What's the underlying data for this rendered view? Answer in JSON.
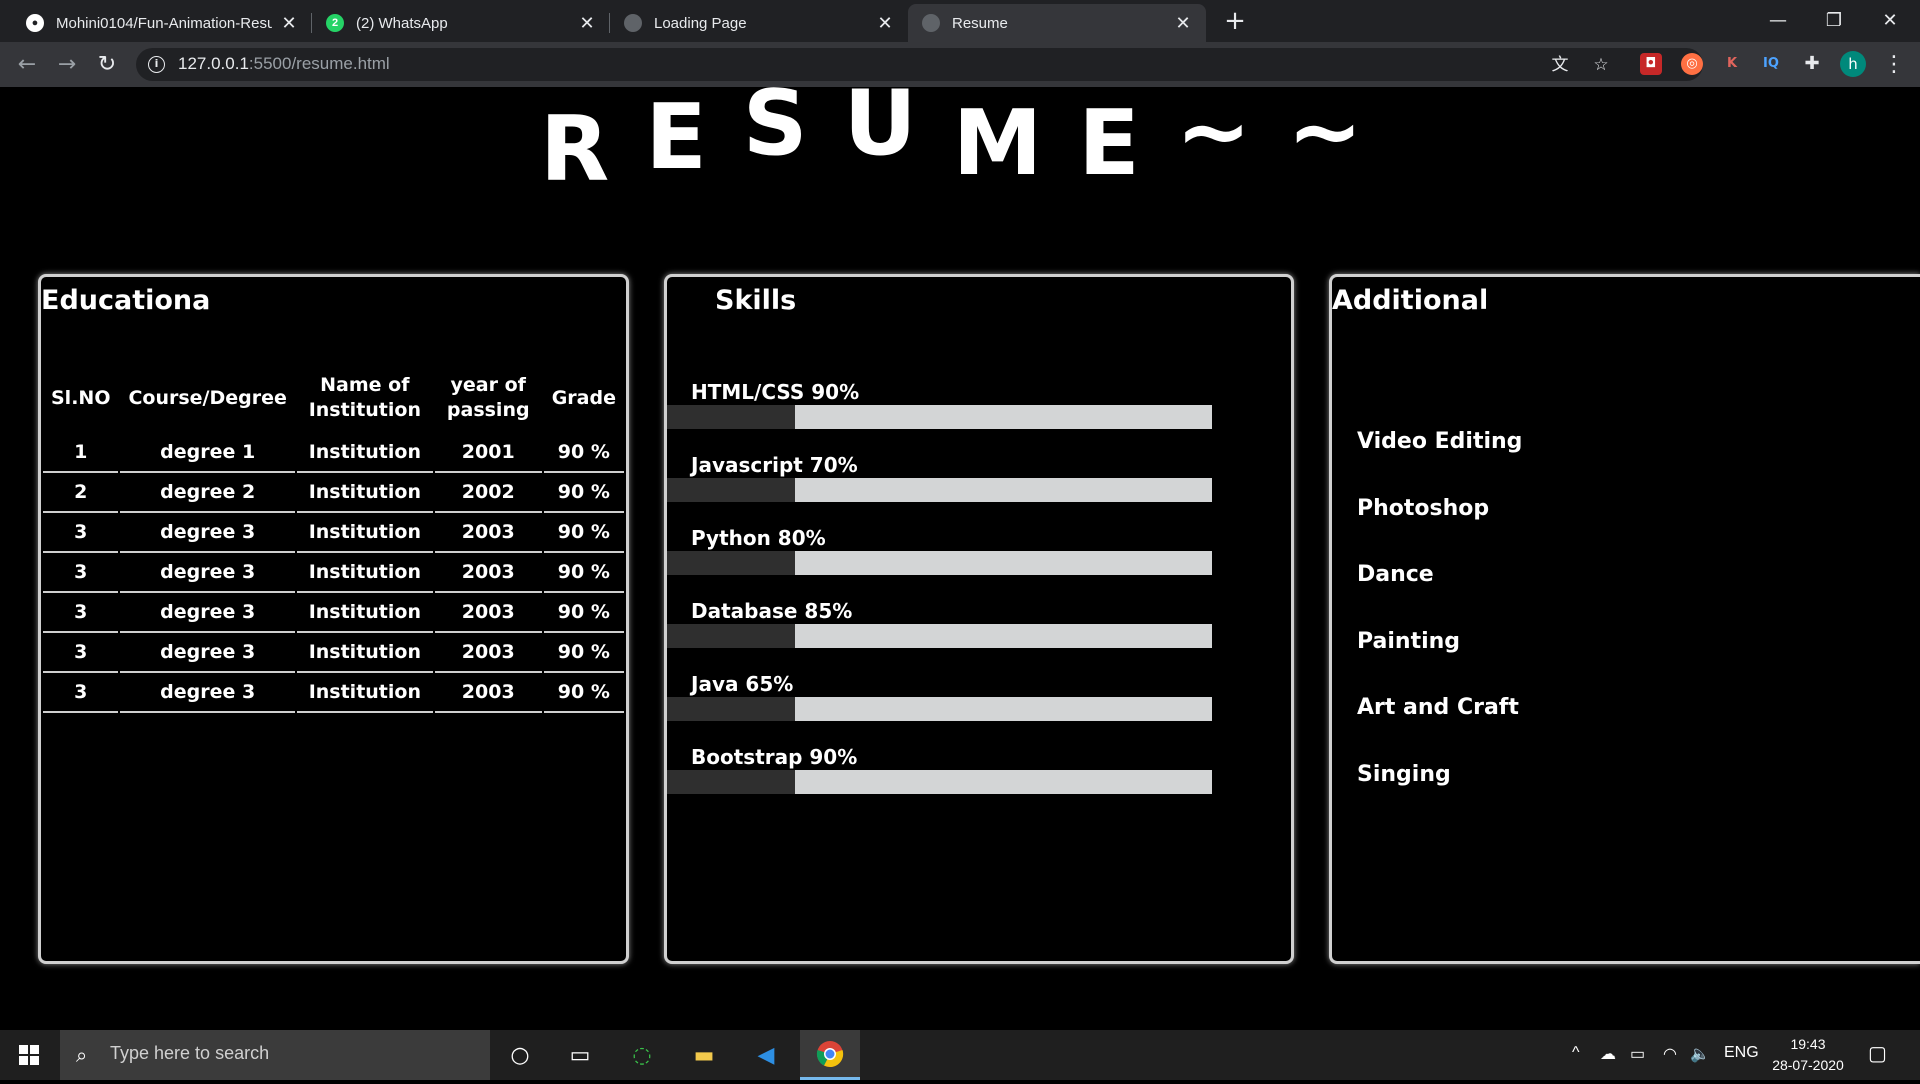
{
  "browser": {
    "tabs": [
      {
        "title": "Mohini0104/Fun-Animation-Resume",
        "icon": "github-icon"
      },
      {
        "title": "(2) WhatsApp",
        "icon": "whatsapp-icon",
        "badge": "2"
      },
      {
        "title": "Loading Page",
        "icon": "globe-icon"
      },
      {
        "title": "Resume",
        "icon": "globe-icon"
      }
    ],
    "new_tab": "+",
    "url_host": "127.0.0.1",
    "url_rest": ":5500/resume.html",
    "profile_initial": "h",
    "ext_k": "K",
    "ext_iq": "IQ"
  },
  "resume": {
    "title_letters": [
      "R",
      "E",
      "S",
      "U",
      "M",
      "E",
      "~",
      "~"
    ],
    "education": {
      "heading": "Educationa",
      "headers": [
        "Sl.NO",
        "Course/Degree",
        "Name of Institution",
        "year of passing",
        "Grade"
      ],
      "rows": [
        [
          "1",
          "degree 1",
          "Institution",
          "2001",
          "90 %"
        ],
        [
          "2",
          "degree 2",
          "Institution",
          "2002",
          "90 %"
        ],
        [
          "3",
          "degree 3",
          "Institution",
          "2003",
          "90 %"
        ],
        [
          "3",
          "degree 3",
          "Institution",
          "2003",
          "90 %"
        ],
        [
          "3",
          "degree 3",
          "Institution",
          "2003",
          "90 %"
        ],
        [
          "3",
          "degree 3",
          "Institution",
          "2003",
          "90 %"
        ],
        [
          "3",
          "degree 3",
          "Institution",
          "2003",
          "90 %"
        ]
      ]
    },
    "skills": {
      "heading": "Skills",
      "items": [
        {
          "label": "HTML/CSS 90%",
          "level": 0.9
        },
        {
          "label": "Javascript 70%",
          "level": 0.7
        },
        {
          "label": "Python 80%",
          "level": 0.8
        },
        {
          "label": "Database 85%",
          "level": 0.85
        },
        {
          "label": "Java 65%",
          "level": 0.65
        },
        {
          "label": "Bootstrap 90%",
          "level": 0.9
        }
      ]
    },
    "additional": {
      "heading": "Additional S",
      "items": [
        "Video Editing",
        "Photoshop",
        "Dance",
        "Painting",
        "Art and Craft",
        "Singing"
      ]
    }
  },
  "taskbar": {
    "search_placeholder": "Type here to search",
    "language": "ENG",
    "time": "19:43",
    "date": "28-07-2020"
  }
}
